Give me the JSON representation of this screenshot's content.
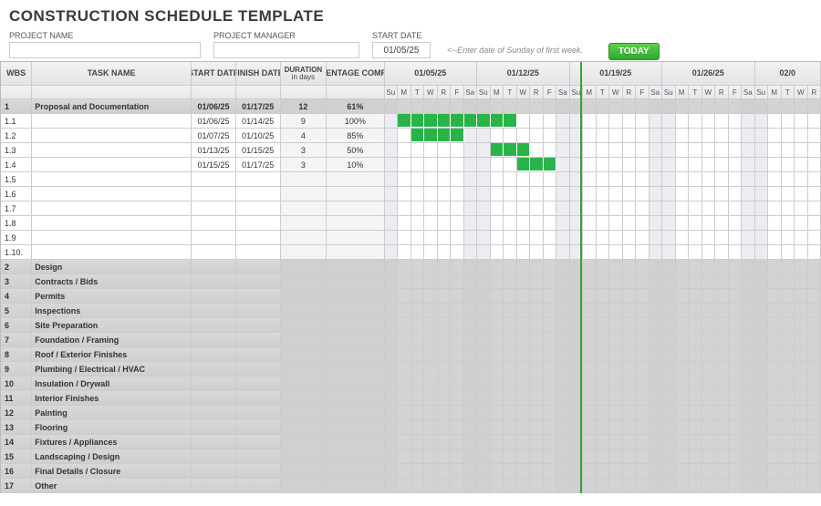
{
  "title": "CONSTRUCTION SCHEDULE TEMPLATE",
  "meta": {
    "project_name_label": "PROJECT NAME",
    "project_manager_label": "PROJECT MANAGER",
    "start_date_label": "START DATE",
    "start_date_value": "01/05/25",
    "hint": "<--Enter date of Sunday of first week.",
    "today_label": "TODAY"
  },
  "cols": {
    "wbs": "WBS",
    "task": "TASK NAME",
    "start": "START DATE",
    "finish": "FINISH DATE",
    "duration": "DURATION",
    "duration_sub": "in days",
    "pct": "PERCENTAGE COMPLETE"
  },
  "week_headers": [
    "01/05/25",
    "01/12/25",
    "01/19/25",
    "01/26/25",
    "02/0"
  ],
  "day_labels": [
    "Su",
    "M",
    "T",
    "W",
    "R",
    "F",
    "Sa"
  ],
  "rows": [
    {
      "wbs": "1",
      "task": "Proposal and Documentation",
      "start": "01/06/25",
      "finish": "01/17/25",
      "dur": "12",
      "pct": "61%",
      "section": true,
      "fill": []
    },
    {
      "wbs": "1.1",
      "task": "",
      "start": "01/06/25",
      "finish": "01/14/25",
      "dur": "9",
      "pct": "100%",
      "fill": [
        1,
        2,
        3,
        4,
        5,
        6,
        7,
        8,
        9
      ]
    },
    {
      "wbs": "1.2",
      "task": "",
      "start": "01/07/25",
      "finish": "01/10/25",
      "dur": "4",
      "pct": "85%",
      "fill": [
        2,
        3,
        4,
        5
      ]
    },
    {
      "wbs": "1.3",
      "task": "",
      "start": "01/13/25",
      "finish": "01/15/25",
      "dur": "3",
      "pct": "50%",
      "fill": [
        8,
        9,
        10
      ]
    },
    {
      "wbs": "1.4",
      "task": "",
      "start": "01/15/25",
      "finish": "01/17/25",
      "dur": "3",
      "pct": "10%",
      "fill": [
        10,
        11,
        12
      ]
    },
    {
      "wbs": "1.5",
      "task": "",
      "start": "",
      "finish": "",
      "dur": "",
      "pct": ""
    },
    {
      "wbs": "1.6",
      "task": "",
      "start": "",
      "finish": "",
      "dur": "",
      "pct": ""
    },
    {
      "wbs": "1.7",
      "task": "",
      "start": "",
      "finish": "",
      "dur": "",
      "pct": ""
    },
    {
      "wbs": "1.8",
      "task": "",
      "start": "",
      "finish": "",
      "dur": "",
      "pct": ""
    },
    {
      "wbs": "1.9",
      "task": "",
      "start": "",
      "finish": "",
      "dur": "",
      "pct": ""
    },
    {
      "wbs": "1.10.",
      "task": "",
      "start": "",
      "finish": "",
      "dur": "",
      "pct": ""
    },
    {
      "wbs": "2",
      "task": "Design",
      "section": true
    },
    {
      "wbs": "3",
      "task": "Contracts / Bids",
      "section": true
    },
    {
      "wbs": "4",
      "task": "Permits",
      "section": true
    },
    {
      "wbs": "5",
      "task": "Inspections",
      "section": true
    },
    {
      "wbs": "6",
      "task": "Site Preparation",
      "section": true
    },
    {
      "wbs": "7",
      "task": "Foundation / Framing",
      "section": true
    },
    {
      "wbs": "8",
      "task": "Roof / Exterior Finishes",
      "section": true
    },
    {
      "wbs": "9",
      "task": "Plumbing / Electrical / HVAC",
      "section": true
    },
    {
      "wbs": "10",
      "task": "Insulation / Drywall",
      "section": true
    },
    {
      "wbs": "11",
      "task": "Interior Finishes",
      "section": true
    },
    {
      "wbs": "12",
      "task": "Painting",
      "section": true
    },
    {
      "wbs": "13",
      "task": "Flooring",
      "section": true
    },
    {
      "wbs": "14",
      "task": "Fixtures / Appliances",
      "section": true
    },
    {
      "wbs": "15",
      "task": "Landscaping / Design",
      "section": true
    },
    {
      "wbs": "16",
      "task": "Final Details / Closure",
      "section": true
    },
    {
      "wbs": "17",
      "task": "Other",
      "section": true
    }
  ],
  "today_day_index": 14,
  "total_days": 33
}
